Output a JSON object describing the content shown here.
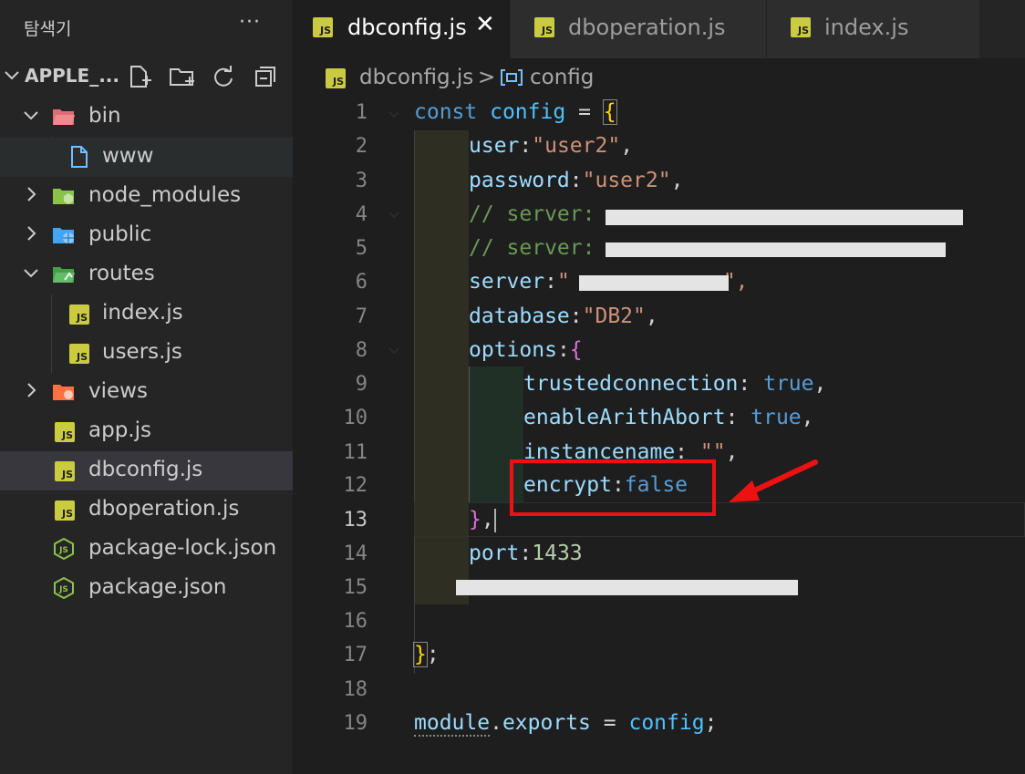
{
  "explorer": {
    "title": "탐색기",
    "more": "···",
    "root_label": "APPLE_...",
    "tree": [
      {
        "label": "bin"
      },
      {
        "label": "www"
      },
      {
        "label": "node_modules"
      },
      {
        "label": "public"
      },
      {
        "label": "routes"
      },
      {
        "label": "index.js"
      },
      {
        "label": "users.js"
      },
      {
        "label": "views"
      },
      {
        "label": "app.js"
      },
      {
        "label": "dbconfig.js"
      },
      {
        "label": "dboperation.js"
      },
      {
        "label": "package-lock.json"
      },
      {
        "label": "package.json"
      }
    ]
  },
  "tabs": [
    {
      "label": "dbconfig.js",
      "badge": "JS",
      "close": "✕"
    },
    {
      "label": "dboperation.js",
      "badge": "JS"
    },
    {
      "label": "index.js",
      "badge": "JS"
    }
  ],
  "breadcrumb": {
    "file": "dbconfig.js",
    "sep": ">",
    "symbol": "config"
  },
  "line_numbers": [
    "1",
    "2",
    "3",
    "4",
    "5",
    "6",
    "7",
    "8",
    "9",
    "10",
    "11",
    "12",
    "13",
    "14",
    "15",
    "16",
    "17",
    "18",
    "19"
  ],
  "code": {
    "l1": {
      "kw": "const",
      "name": "config",
      "eq": "=",
      "brace": "{"
    },
    "l2": {
      "key": "user",
      "colon": ":",
      "val": "\"user2\"",
      "comma": ","
    },
    "l3": {
      "key": "password",
      "colon": ":",
      "val": "\"user2\"",
      "comma": ","
    },
    "l4": {
      "comment": "// server:"
    },
    "l5": {
      "comment": "// server:"
    },
    "l6": {
      "key": "server",
      "colon": ":",
      "open": "\"",
      "close": "\","
    },
    "l7": {
      "key": "database",
      "colon": ":",
      "val": "\"DB2\"",
      "comma": ","
    },
    "l8": {
      "key": "options",
      "colon": ":",
      "brace": "{"
    },
    "l9": {
      "key": "trustedconnection",
      "colon": ": ",
      "val": "true",
      "comma": ","
    },
    "l10": {
      "key": "enableArithAbort",
      "colon": ": ",
      "val": "true",
      "comma": ","
    },
    "l11": {
      "key": "instancename",
      "colon": ": ",
      "val": "\"\"",
      "comma": ","
    },
    "l12": {
      "key": "encrypt",
      "colon": ":",
      "val": "false"
    },
    "l13": {
      "brace": "}",
      "comma": ","
    },
    "l14": {
      "key": "port",
      "colon": ":",
      "val": "1433"
    },
    "l17": {
      "brace": "}",
      "semi": ";"
    },
    "l19": {
      "obj": "module",
      "dot": ".",
      "prop": "exports",
      "eq": "=",
      "name": "config",
      "semi": ";"
    }
  },
  "colors": {
    "annotation": "#ee1111",
    "editor_bg": "#1e1e1e",
    "sidebar_bg": "#252526"
  }
}
